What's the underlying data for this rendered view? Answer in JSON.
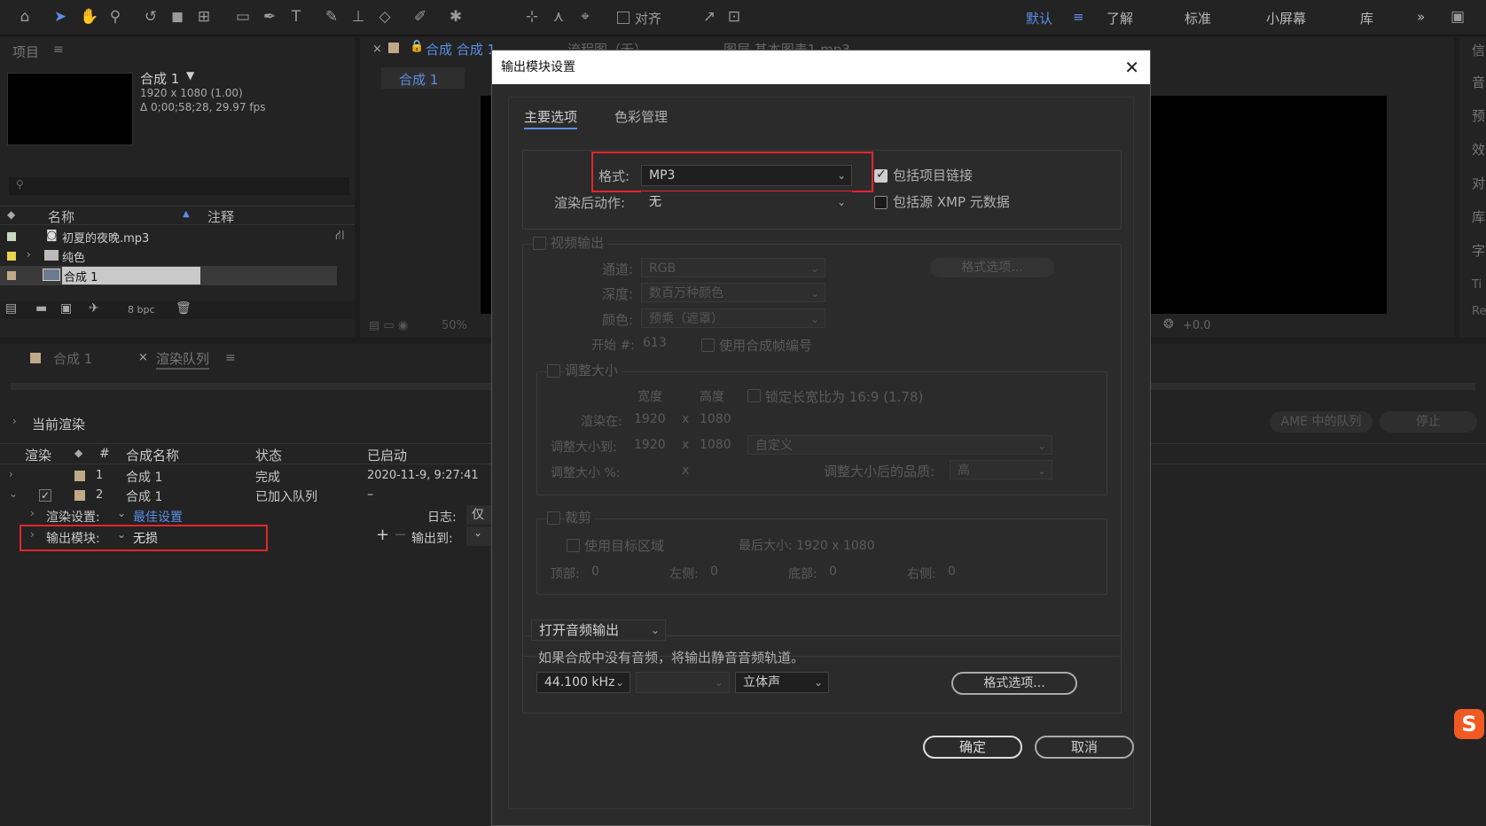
{
  "workspace": {
    "items": [
      "默认",
      "了解",
      "标准",
      "小屏幕",
      "库"
    ],
    "more": "»"
  },
  "toolbar": {
    "snap_label": "对齐"
  },
  "project": {
    "tab": "项目",
    "comp_name": "合成 1",
    "comp_res": "1920 x 1080 (1.00)",
    "comp_duration": "Δ 0;00;58;28, 29.97 fps",
    "col_name": "名称",
    "col_comment": "注释",
    "items": [
      "初夏的夜晚.mp3",
      "纯色",
      "合成 1"
    ],
    "bpc": "8 bpc"
  },
  "viewer": {
    "tab": "合成 合成 1",
    "tab_flow": "流程图（无）",
    "tab_layer": "图层 基本图表1 mp3",
    "comp_tab": "合成 1",
    "zoom": "50%",
    "exposure": "+0.0"
  },
  "render_panel": {
    "tab_comp": "合成 1",
    "tab_queue": "渲染队列",
    "current_render": "当前渲染",
    "col_render": "渲染",
    "col_num": "#",
    "col_comp": "合成名称",
    "col_status": "状态",
    "col_started": "已启动",
    "rows": [
      {
        "num": "1",
        "name": "合成 1",
        "status": "完成",
        "started": "2020-11-9, 9:27:41"
      },
      {
        "num": "2",
        "name": "合成 1",
        "status": "已加入队列",
        "started": "–"
      }
    ],
    "render_settings_label": "渲染设置:",
    "render_settings_value": "最佳设置",
    "output_module_label": "输出模块:",
    "output_module_value": "无损",
    "log_label": "日志:",
    "log_value": "仅",
    "output_to_label": "输出到:",
    "ame_button": "AME 中的队列",
    "stop_button": "停止"
  },
  "right_panel_letters": [
    "信",
    "音",
    "预",
    "效",
    "对",
    "库",
    "字",
    "Ti",
    "Re"
  ],
  "dialog": {
    "title": "输出模块设置",
    "tab_main": "主要选项",
    "tab_color": "色彩管理",
    "format_label": "格式:",
    "format_value": "MP3",
    "post_render_label": "渲染后动作:",
    "post_render_value": "无",
    "include_project_link": "包括项目链接",
    "include_xmp": "包括源 XMP 元数据",
    "video_output": "视频输出",
    "channels_label": "通道:",
    "channels_value": "RGB",
    "format_options": "格式选项...",
    "depth_label": "深度:",
    "depth_value": "数百万种颜色",
    "color_label": "颜色:",
    "color_value": "预乘（遮罩）",
    "start_label": "开始 #:",
    "start_value": "613",
    "use_comp_frame": "使用合成帧编号",
    "resize": "调整大小",
    "width_label": "宽度",
    "height_label": "高度",
    "lock_aspect": "锁定长宽比为 16:9 (1.78)",
    "render_at_label": "渲染在:",
    "render_at_w": "1920",
    "render_at_h": "1080",
    "resize_to_label": "调整大小到:",
    "resize_to_w": "1920",
    "resize_to_h": "1080",
    "resize_preset": "自定义",
    "resize_pct_label": "调整大小 %:",
    "x": "x",
    "quality_label": "调整大小后的品质:",
    "quality_value": "高",
    "crop": "裁剪",
    "use_roi": "使用目标区域",
    "final_size": "最后大小: 1920 x 1080",
    "top_label": "顶部:",
    "top_value": "0",
    "left_label": "左侧:",
    "left_value": "0",
    "bottom_label": "底部:",
    "bottom_value": "0",
    "right_label": "右侧:",
    "right_value": "0",
    "audio_mode": "打开音频输出",
    "audio_note": "如果合成中没有音频，将输出静音音频轨道。",
    "sample_rate": "44.100 kHz",
    "channels_audio": "立体声",
    "audio_format_options": "格式选项...",
    "ok": "确定",
    "cancel": "取消"
  }
}
